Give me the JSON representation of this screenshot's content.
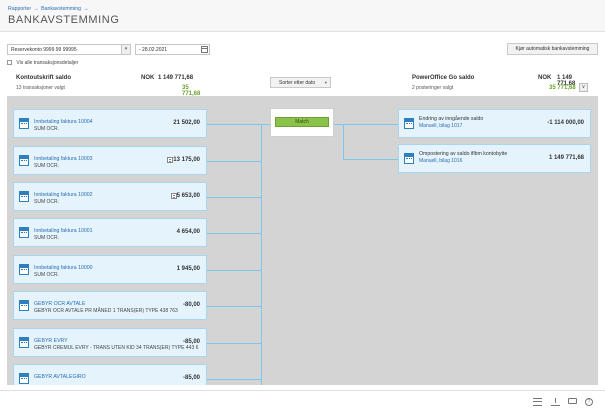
{
  "breadcrumb": {
    "item1": "Rapporter",
    "item2": "Bankavstemming",
    "sep": "→"
  },
  "page_title": "BANKAVSTEMMING",
  "controls": {
    "account_select": "Reservekonto 9999 99 99995",
    "date_value": "- 28.02.2021",
    "auto_button": "Kjør automatisk bankavstemming",
    "checkbox_label": "Vis alle transaksjonsdetaljer"
  },
  "left_summary": {
    "title": "Kontoutskrift saldo",
    "sub": "13 transaksjoner valgt",
    "currency": "NOK",
    "amount": "1 149 771,68",
    "selected": "35 771,68"
  },
  "right_summary": {
    "title": "PowerOffice Go saldo",
    "sub": "2 posteringer valgt",
    "currency": "NOK",
    "amount": "1 149 771,68",
    "selected": "35 771,68",
    "expand_symbol": "∨"
  },
  "sort_button": {
    "label": "Sorter etter dato",
    "arrow": "▾"
  },
  "match_button": "Match",
  "left_items": [
    {
      "name": "Innbetaling faktura 10004",
      "desc": "SUM OCR.",
      "amount": "21 502,00",
      "note": false
    },
    {
      "name": "Innbetaling faktura 10003",
      "desc": "SUM OCR.",
      "amount": "13 175,00",
      "note": true
    },
    {
      "name": "Innbetaling faktura 10002",
      "desc": "SUM OCR.",
      "amount": "5 653,00",
      "note": true
    },
    {
      "name": "Innbetaling faktura 10001",
      "desc": "SUM OCR.",
      "amount": "4 654,00",
      "note": false
    },
    {
      "name": "Innbetaling faktura 10000",
      "desc": "SUM OCR.",
      "amount": "1 945,00",
      "note": false
    },
    {
      "name": "GEBYR OCR AVTALE",
      "desc": "GEBYR OCR AVTALE PR MÅNED 1 TRANS(ER) TYPE 438 763",
      "amount": "-80,00",
      "note": false
    },
    {
      "name": "GEBYR EVRY",
      "desc": "GEBYR CREMUL EVRY - TRANS UTEN KID 34 TRANS(ER) TYPE 443 6",
      "amount": "-85,00",
      "note": false
    },
    {
      "name": "GEBYR AVTALEGIRO",
      "desc": "",
      "amount": "-85,00",
      "note": false
    }
  ],
  "right_items": [
    {
      "name": "Endring av inngående saldo",
      "desc": "Manuell, bilag 1017",
      "amount": "-1 114 000,00"
    },
    {
      "name": "Ompostering av saldo iflbm kontobytte",
      "desc": "Manuell, bilag 1016",
      "amount": "1 149 771,68"
    }
  ],
  "footer_icons": [
    "list-icon",
    "download-icon",
    "chat-icon",
    "help-icon"
  ],
  "help_symbol": "?",
  "colors": {
    "accent_blue": "#2a6cb5",
    "match_green": "#8bc34a",
    "selected_green": "#6aa32c",
    "card_bg": "#e5f4fc"
  }
}
